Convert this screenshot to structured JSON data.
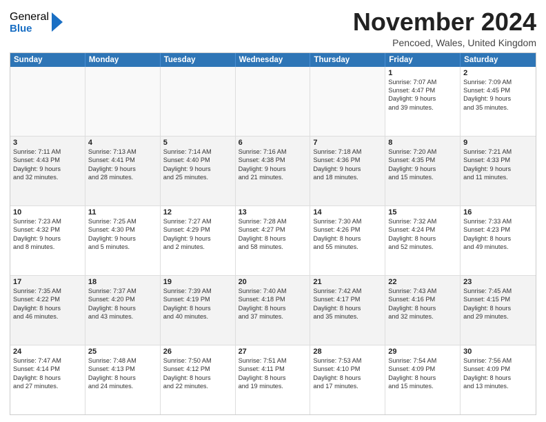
{
  "logo": {
    "general": "General",
    "blue": "Blue"
  },
  "title": "November 2024",
  "location": "Pencoed, Wales, United Kingdom",
  "days": [
    "Sunday",
    "Monday",
    "Tuesday",
    "Wednesday",
    "Thursday",
    "Friday",
    "Saturday"
  ],
  "weeks": [
    [
      {
        "day": "",
        "lines": []
      },
      {
        "day": "",
        "lines": []
      },
      {
        "day": "",
        "lines": []
      },
      {
        "day": "",
        "lines": []
      },
      {
        "day": "",
        "lines": []
      },
      {
        "day": "1",
        "lines": [
          "Sunrise: 7:07 AM",
          "Sunset: 4:47 PM",
          "Daylight: 9 hours",
          "and 39 minutes."
        ]
      },
      {
        "day": "2",
        "lines": [
          "Sunrise: 7:09 AM",
          "Sunset: 4:45 PM",
          "Daylight: 9 hours",
          "and 35 minutes."
        ]
      }
    ],
    [
      {
        "day": "3",
        "lines": [
          "Sunrise: 7:11 AM",
          "Sunset: 4:43 PM",
          "Daylight: 9 hours",
          "and 32 minutes."
        ]
      },
      {
        "day": "4",
        "lines": [
          "Sunrise: 7:13 AM",
          "Sunset: 4:41 PM",
          "Daylight: 9 hours",
          "and 28 minutes."
        ]
      },
      {
        "day": "5",
        "lines": [
          "Sunrise: 7:14 AM",
          "Sunset: 4:40 PM",
          "Daylight: 9 hours",
          "and 25 minutes."
        ]
      },
      {
        "day": "6",
        "lines": [
          "Sunrise: 7:16 AM",
          "Sunset: 4:38 PM",
          "Daylight: 9 hours",
          "and 21 minutes."
        ]
      },
      {
        "day": "7",
        "lines": [
          "Sunrise: 7:18 AM",
          "Sunset: 4:36 PM",
          "Daylight: 9 hours",
          "and 18 minutes."
        ]
      },
      {
        "day": "8",
        "lines": [
          "Sunrise: 7:20 AM",
          "Sunset: 4:35 PM",
          "Daylight: 9 hours",
          "and 15 minutes."
        ]
      },
      {
        "day": "9",
        "lines": [
          "Sunrise: 7:21 AM",
          "Sunset: 4:33 PM",
          "Daylight: 9 hours",
          "and 11 minutes."
        ]
      }
    ],
    [
      {
        "day": "10",
        "lines": [
          "Sunrise: 7:23 AM",
          "Sunset: 4:32 PM",
          "Daylight: 9 hours",
          "and 8 minutes."
        ]
      },
      {
        "day": "11",
        "lines": [
          "Sunrise: 7:25 AM",
          "Sunset: 4:30 PM",
          "Daylight: 9 hours",
          "and 5 minutes."
        ]
      },
      {
        "day": "12",
        "lines": [
          "Sunrise: 7:27 AM",
          "Sunset: 4:29 PM",
          "Daylight: 9 hours",
          "and 2 minutes."
        ]
      },
      {
        "day": "13",
        "lines": [
          "Sunrise: 7:28 AM",
          "Sunset: 4:27 PM",
          "Daylight: 8 hours",
          "and 58 minutes."
        ]
      },
      {
        "day": "14",
        "lines": [
          "Sunrise: 7:30 AM",
          "Sunset: 4:26 PM",
          "Daylight: 8 hours",
          "and 55 minutes."
        ]
      },
      {
        "day": "15",
        "lines": [
          "Sunrise: 7:32 AM",
          "Sunset: 4:24 PM",
          "Daylight: 8 hours",
          "and 52 minutes."
        ]
      },
      {
        "day": "16",
        "lines": [
          "Sunrise: 7:33 AM",
          "Sunset: 4:23 PM",
          "Daylight: 8 hours",
          "and 49 minutes."
        ]
      }
    ],
    [
      {
        "day": "17",
        "lines": [
          "Sunrise: 7:35 AM",
          "Sunset: 4:22 PM",
          "Daylight: 8 hours",
          "and 46 minutes."
        ]
      },
      {
        "day": "18",
        "lines": [
          "Sunrise: 7:37 AM",
          "Sunset: 4:20 PM",
          "Daylight: 8 hours",
          "and 43 minutes."
        ]
      },
      {
        "day": "19",
        "lines": [
          "Sunrise: 7:39 AM",
          "Sunset: 4:19 PM",
          "Daylight: 8 hours",
          "and 40 minutes."
        ]
      },
      {
        "day": "20",
        "lines": [
          "Sunrise: 7:40 AM",
          "Sunset: 4:18 PM",
          "Daylight: 8 hours",
          "and 37 minutes."
        ]
      },
      {
        "day": "21",
        "lines": [
          "Sunrise: 7:42 AM",
          "Sunset: 4:17 PM",
          "Daylight: 8 hours",
          "and 35 minutes."
        ]
      },
      {
        "day": "22",
        "lines": [
          "Sunrise: 7:43 AM",
          "Sunset: 4:16 PM",
          "Daylight: 8 hours",
          "and 32 minutes."
        ]
      },
      {
        "day": "23",
        "lines": [
          "Sunrise: 7:45 AM",
          "Sunset: 4:15 PM",
          "Daylight: 8 hours",
          "and 29 minutes."
        ]
      }
    ],
    [
      {
        "day": "24",
        "lines": [
          "Sunrise: 7:47 AM",
          "Sunset: 4:14 PM",
          "Daylight: 8 hours",
          "and 27 minutes."
        ]
      },
      {
        "day": "25",
        "lines": [
          "Sunrise: 7:48 AM",
          "Sunset: 4:13 PM",
          "Daylight: 8 hours",
          "and 24 minutes."
        ]
      },
      {
        "day": "26",
        "lines": [
          "Sunrise: 7:50 AM",
          "Sunset: 4:12 PM",
          "Daylight: 8 hours",
          "and 22 minutes."
        ]
      },
      {
        "day": "27",
        "lines": [
          "Sunrise: 7:51 AM",
          "Sunset: 4:11 PM",
          "Daylight: 8 hours",
          "and 19 minutes."
        ]
      },
      {
        "day": "28",
        "lines": [
          "Sunrise: 7:53 AM",
          "Sunset: 4:10 PM",
          "Daylight: 8 hours",
          "and 17 minutes."
        ]
      },
      {
        "day": "29",
        "lines": [
          "Sunrise: 7:54 AM",
          "Sunset: 4:09 PM",
          "Daylight: 8 hours",
          "and 15 minutes."
        ]
      },
      {
        "day": "30",
        "lines": [
          "Sunrise: 7:56 AM",
          "Sunset: 4:09 PM",
          "Daylight: 8 hours",
          "and 13 minutes."
        ]
      }
    ]
  ]
}
